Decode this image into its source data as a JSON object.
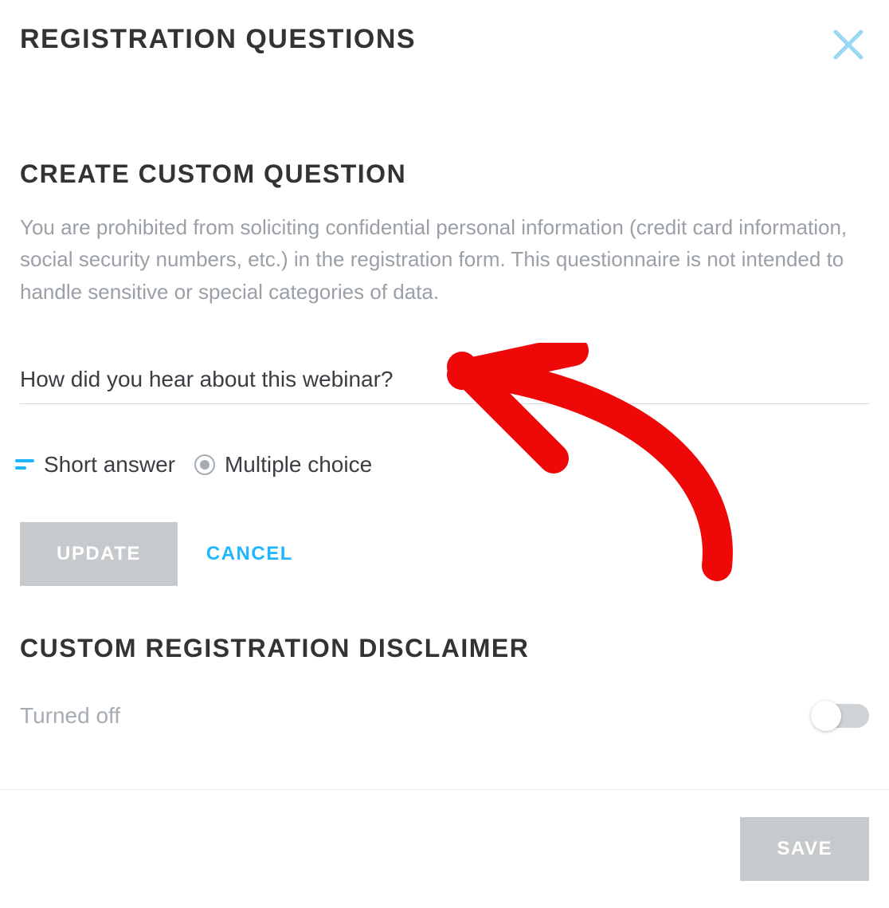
{
  "header": {
    "title": "Registration Questions"
  },
  "section": {
    "title": "Create Custom Question",
    "description": "You are prohibited from soliciting confidential personal information (credit card information, social security numbers, etc.) in the registration form. This questionnaire is not intended to handle sensitive or special categories of data."
  },
  "question": {
    "value": "How did you hear about this webinar?"
  },
  "question_types": {
    "short_answer_label": "Short answer",
    "multiple_choice_label": "Multiple choice",
    "selected": "short_answer"
  },
  "buttons": {
    "update_label": "Update",
    "cancel_label": "Cancel",
    "save_label": "Save"
  },
  "disclaimer": {
    "title": "Custom Registration Disclaimer",
    "status_label": "Turned off",
    "enabled": false
  },
  "colors": {
    "accent": "#1fb6ff",
    "close_icon": "#98d8f3",
    "muted_text": "#9aa0a6",
    "disabled_bg": "#c7cacc"
  }
}
